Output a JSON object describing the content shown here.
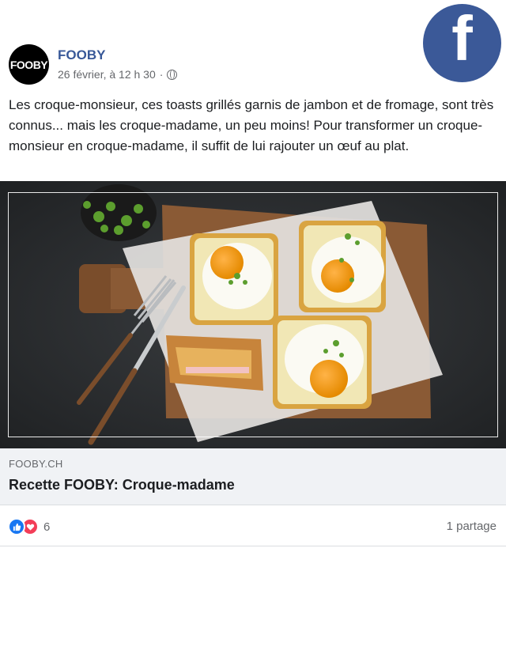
{
  "brand": {
    "facebook_logo": "f",
    "facebook_color": "#3b5998"
  },
  "post": {
    "avatar_text": "FOOBY",
    "page_name": "FOOBY",
    "timestamp": "26 février, à 12 h 30",
    "separator": "·",
    "privacy_icon": "globe-icon",
    "text": "Les croque-monsieur, ces toasts grillés garnis de jambon et de fromage, sont très connus... mais les croque-madame, un peu moins! Pour transformer un croque-monsieur en croque-madame, il suffit de lui rajouter un œuf au plat."
  },
  "link_preview": {
    "domain": "FOOBY.CH",
    "title": "Recette FOOBY: Croque-madame"
  },
  "engagement": {
    "reaction_icons": [
      "like-icon",
      "love-icon"
    ],
    "reaction_count": "6",
    "shares": "1 partage"
  }
}
